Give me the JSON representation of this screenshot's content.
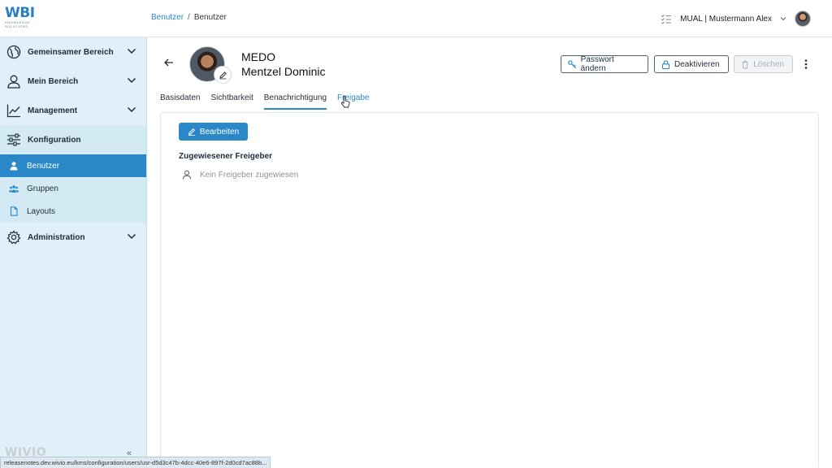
{
  "header": {
    "logo_main": "WBI",
    "logo_sub": "KNOWLEDGE SOLUTIONS",
    "breadcrumb": {
      "root": "Benutzer",
      "separator": "/",
      "current": "Benutzer"
    },
    "user_label": "MUAL | Mustermann Alex"
  },
  "sidebar": {
    "groups": [
      {
        "label": "Gemeinsamer Bereich",
        "icon": "globe-icon"
      },
      {
        "label": "Mein Bereich",
        "icon": "user-icon"
      },
      {
        "label": "Management",
        "icon": "chart-line-icon"
      },
      {
        "label": "Konfiguration",
        "icon": "sliders-icon"
      },
      {
        "label": "Administration",
        "icon": "gear-icon"
      }
    ],
    "config_items": [
      {
        "label": "Benutzer",
        "icon": "user-icon",
        "active": true
      },
      {
        "label": "Gruppen",
        "icon": "users-icon",
        "active": false
      },
      {
        "label": "Layouts",
        "icon": "document-icon",
        "active": false
      }
    ],
    "footer_brand": "WIVIO",
    "collapse_glyph": "«"
  },
  "profile": {
    "short_code": "MEDO",
    "full_name": "Mentzel Dominic"
  },
  "actions": {
    "change_password": "Passwort ändern",
    "deactivate": "Deaktivieren",
    "delete": "Löschen"
  },
  "tabs": [
    {
      "label": "Basisdaten"
    },
    {
      "label": "Sichtbarkeit"
    },
    {
      "label": "Benachrichtigung",
      "selected": true
    },
    {
      "label": "Freigabe",
      "hover": true
    }
  ],
  "content": {
    "edit_button": "Bearbeiten",
    "section_title": "Zugewiesener Freigeber",
    "empty_text": "Kein Freigeber zugewiesen"
  },
  "status_url": "releasenotes.dev.wivio.eu/kms/configuration/users/usr-d5d3c47b-4dcc-40e6-897f-2d0cd7ac88b...",
  "colors": {
    "accent": "#2a88c9",
    "sidebar_bg": "#dff0f8"
  }
}
